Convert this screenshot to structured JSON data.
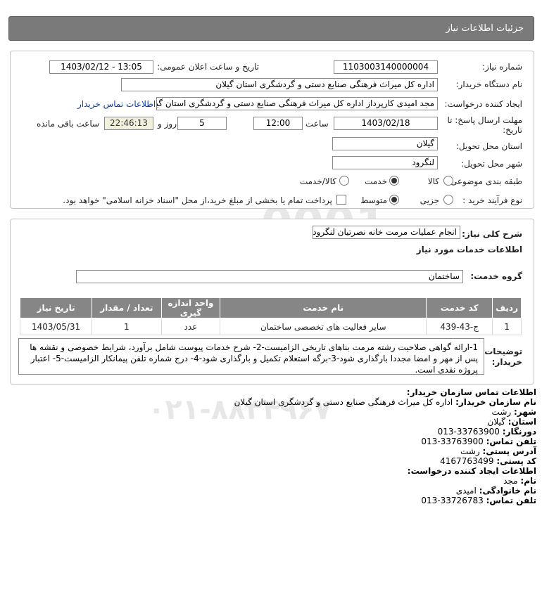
{
  "header": {
    "title": "جزئیات اطلاعات نیاز"
  },
  "form": {
    "need_number": {
      "label": "شماره نیاز:",
      "value": "1103003140000004"
    },
    "announce_datetime": {
      "label": "تاریخ و ساعت اعلان عمومی:",
      "value": "1403/02/12 - 13:05"
    },
    "buyer_org": {
      "label": "نام دستگاه خریدار:",
      "value": "اداره کل میراث فرهنگی  صنایع دستی و گردشگری استان گیلان"
    },
    "requester": {
      "label": "ایجاد کننده درخواست:",
      "value": "مجد امیدی کارپرداز اداره کل میراث فرهنگی  صنایع دستی و گردشگری استان گیلان",
      "contact_link": "اطلاعات تماس خریدار"
    },
    "deadline": {
      "label_line1": "مهلت ارسال پاسخ: تا",
      "label_line2": "تاریخ:",
      "date": "1403/02/18",
      "time_label": "ساعت",
      "time": "12:00",
      "days": "5",
      "days_label": "روز و",
      "remaining": "22:46:13",
      "remaining_label": "ساعت باقی مانده"
    },
    "province": {
      "label": "استان محل تحویل:",
      "value": "گیلان"
    },
    "city": {
      "label": "شهر محل تحویل:",
      "value": "لنگرود"
    },
    "category": {
      "label": "طبقه بندی موضوعی:",
      "options": [
        "کالا",
        "خدمت",
        "کالا/خدمت"
      ],
      "selected": "خدمت"
    },
    "purchase_type": {
      "label": "نوع فرآیند خرید :",
      "options": [
        "جزیی",
        "متوسط"
      ],
      "selected": "متوسط",
      "checkbox_label": "پرداخت تمام یا بخشی از مبلغ خرید،از محل \"اسناد خزانه اسلامی\" خواهد بود."
    }
  },
  "summary": {
    "label": "شرح کلی نیاز:",
    "value": "انجام عملیات مرمت خانه نصرتیان لنگرود",
    "services_title": "اطلاعات خدمات مورد نیاز",
    "service_group_label": "گروه خدمت:",
    "service_group_value": "ساختمان"
  },
  "table": {
    "headers": [
      "ردیف",
      "کد خدمت",
      "نام خدمت",
      "واحد اندازه گیری",
      "تعداد / مقدار",
      "تاریخ نیاز"
    ],
    "rows": [
      [
        "1",
        "ج-43-439",
        "سایر فعالیت های تخصصی ساختمان",
        "عدد",
        "1",
        "1403/05/31"
      ]
    ]
  },
  "buyer_notes": {
    "label_line1": "توضیحات",
    "label_line2": "خریدار:",
    "text": "1-ارائه گواهی صلاحیت رشته مرمت بناهای تاریخی الزامیست-2- شرح خدمات پیوست شامل برآورد، شرایط خصوصی و نقشه ها پس از مهر و امضا مجددا بارگذاری شود-3-برگه استعلام تکمیل و بارگذاری شود-4- درج شماره تلفن پیمانکار الزامیست-5- اعتبار پروژه نقدی است."
  },
  "contact": {
    "title": "اطلاعات تماس سازمان خریدار:",
    "org_label": "نام سازمان خریدار:",
    "org_value": "اداره کل میراث فرهنگی صنایع دستی و گردشگری استان گیلان",
    "city_label": "شهر:",
    "city_value": "رشت",
    "province_label": "استان:",
    "province_value": "گیلان",
    "fax_label": "دورنگار:",
    "fax_value": "33763900-013",
    "phone_label": "تلفن تماس:",
    "phone_value": "33763900-013",
    "address_label": "آدرس پستی:",
    "address_value": "رشت",
    "postal_label": "کد پستی:",
    "postal_value": "4167763499",
    "creator_title": "اطلاعات ایجاد کننده درخواست:",
    "name_label": "نام:",
    "name_value": "مجد",
    "family_label": "نام خانوادگی:",
    "family_value": "امیدی",
    "creator_phone_label": "تلفن تماس:",
    "creator_phone_value": "33726783-013"
  }
}
